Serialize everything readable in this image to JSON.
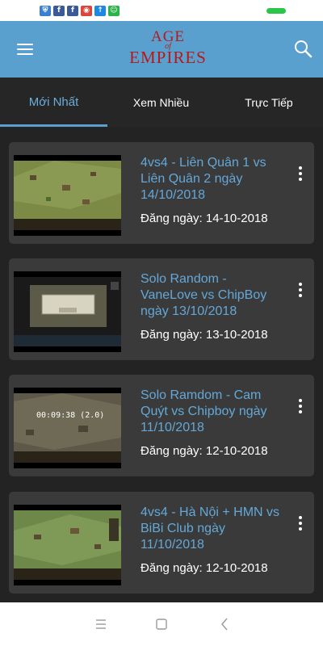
{
  "status_bar": {
    "notification_icons": [
      {
        "icon": "shield-icon",
        "glyph": "⛨",
        "color": "#3a7fd5"
      },
      {
        "icon": "facebook-icon",
        "glyph": "f",
        "color": "#3b5998"
      },
      {
        "icon": "facebook-icon",
        "glyph": "f",
        "color": "#3b5998"
      },
      {
        "icon": "camera-icon",
        "glyph": "◉",
        "color": "#d9473a"
      },
      {
        "icon": "upload-icon",
        "glyph": "↑",
        "color": "#1e88e5"
      },
      {
        "icon": "messenger-icon",
        "glyph": "☺",
        "color": "#2cb34a"
      }
    ],
    "battery_color": "#2cc44a"
  },
  "app_bar": {
    "logo_top": "AGE",
    "logo_of": "of",
    "logo_bottom": "EMPIRES",
    "background": "#5aa0cf",
    "logo_color": "#b41a1a"
  },
  "tabs": [
    {
      "label": "Mới Nhất",
      "active": true
    },
    {
      "label": "Xem Nhiều",
      "active": false
    },
    {
      "label": "Trực Tiếp",
      "active": false
    }
  ],
  "videos": [
    {
      "title": "4vs4 - Liên Quân 1 vs Liên Quân 2 ngày 14/10/2018",
      "date": "Đăng ngày: 14-10-2018"
    },
    {
      "title": "Solo Random - VaneLove vs ChipBoy ngày 13/10/2018",
      "date": "Đăng ngày: 13-10-2018"
    },
    {
      "title": "Solo Ramdom - Cam Quýt vs Chipboy ngày 11/10/2018",
      "date": "Đăng ngày: 12-10-2018",
      "overlay_text": "00:09:38 (2.0)"
    },
    {
      "title": "4vs4 - Hà Nội + HMN vs BiBi Club ngày 11/10/2018",
      "date": "Đăng ngày: 12-10-2018"
    }
  ],
  "colors": {
    "accent": "#5aa0cf",
    "title_text": "#64a8d8",
    "card_bg": "#3a3a3a",
    "page_bg": "#232323"
  }
}
